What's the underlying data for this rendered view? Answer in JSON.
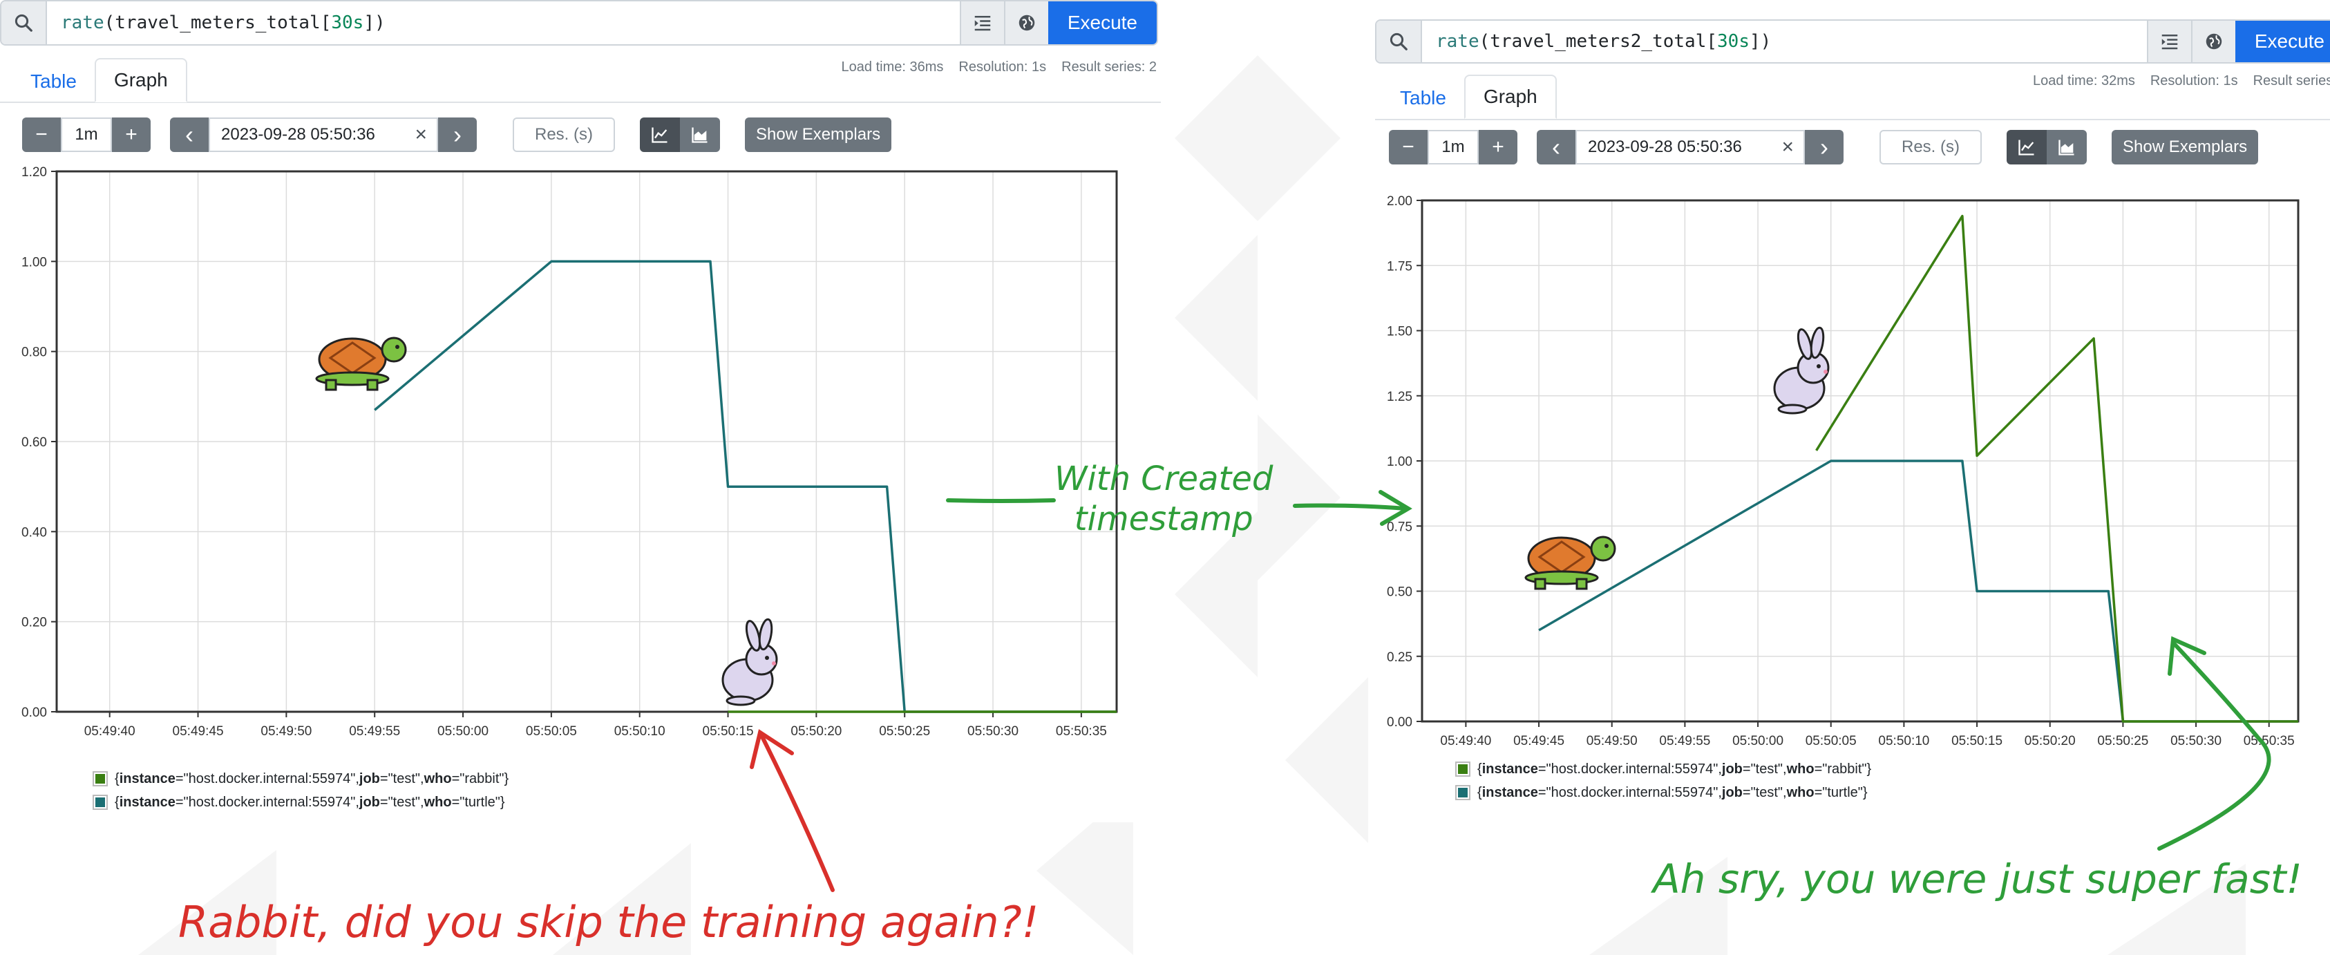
{
  "colors": {
    "rabbit_series": "#3a7f12",
    "turtle_series": "#1b6f73",
    "execute_button": "#1a6ee8",
    "annotation_red": "#d9302b",
    "annotation_green": "#2f9e3a"
  },
  "left_panel": {
    "query": {
      "fn": "rate",
      "metric": "travel_meters_total",
      "range": "30s"
    },
    "execute_label": "Execute",
    "tabs": [
      "Table",
      "Graph"
    ],
    "active_tab": "Graph",
    "stats": {
      "load": "Load time: 36ms",
      "resolution": "Resolution: 1s",
      "series": "Result series: 2"
    },
    "controls": {
      "minus": "−",
      "range": "1m",
      "plus": "+",
      "prev": "‹",
      "end_time": "2023-09-28 05:50:36",
      "clear": "×",
      "next": "›",
      "res_placeholder": "Res. (s)",
      "line_icon": "line-chart-icon",
      "stacked_icon": "stacked-chart-icon",
      "exemplars": "Show Exemplars"
    },
    "legend": [
      {
        "color": "#3a7f12",
        "prefix": "{",
        "k1": "instance",
        "v1": "=\"host.docker.internal:55974\", ",
        "k2": "job",
        "v2": "=\"test\", ",
        "k3": "who",
        "v3": "=\"rabbit\"}"
      },
      {
        "color": "#1b6f73",
        "prefix": "{",
        "k1": "instance",
        "v1": "=\"host.docker.internal:55974\", ",
        "k2": "job",
        "v2": "=\"test\", ",
        "k3": "who",
        "v3": "=\"turtle\"}"
      }
    ]
  },
  "right_panel": {
    "query": {
      "fn": "rate",
      "metric": "travel_meters2_total",
      "range": "30s"
    },
    "execute_label": "Execute",
    "tabs": [
      "Table",
      "Graph"
    ],
    "active_tab": "Graph",
    "stats": {
      "load": "Load time: 32ms",
      "resolution": "Resolution: 1s",
      "series": "Result series:"
    },
    "controls": {
      "minus": "−",
      "range": "1m",
      "plus": "+",
      "prev": "‹",
      "end_time": "2023-09-28 05:50:36",
      "clear": "×",
      "next": "›",
      "res_placeholder": "Res. (s)",
      "exemplars": "Show Exemplars"
    },
    "legend": [
      {
        "color": "#3a7f12",
        "prefix": "{",
        "k1": "instance",
        "v1": "=\"host.docker.internal:55974\", ",
        "k2": "job",
        "v2": "=\"test\", ",
        "k3": "who",
        "v3": "=\"rabbit\"}"
      },
      {
        "color": "#1b6f73",
        "prefix": "{",
        "k1": "instance",
        "v1": "=\"host.docker.internal:55974\", ",
        "k2": "job",
        "v2": "=\"test\", ",
        "k3": "who",
        "v3": "=\"turtle\"}"
      }
    ]
  },
  "annotations": {
    "middle": [
      "With Created",
      "timestamp"
    ],
    "bottom_left": "Rabbit, did you skip the training again?!",
    "bottom_right": "Ah sry, you were just super fast!"
  },
  "chart_data": [
    {
      "type": "line",
      "x_unit": "time",
      "x_ticks": [
        "05:49:40",
        "05:49:45",
        "05:49:50",
        "05:49:55",
        "05:50:00",
        "05:50:05",
        "05:50:10",
        "05:50:15",
        "05:50:20",
        "05:50:25",
        "05:50:30",
        "05:50:35"
      ],
      "y_ticks": [
        "0.00",
        "0.20",
        "0.40",
        "0.60",
        "0.80",
        "1.00",
        "1.20"
      ],
      "ylim": [
        0,
        1.2
      ],
      "xlim": [
        "05:49:37",
        "05:50:37"
      ],
      "grid": true,
      "series": [
        {
          "name": "{instance=\"host.docker.internal:55974\", job=\"test\", who=\"turtle\"}",
          "color": "#1b6f73",
          "points": [
            [
              "05:49:55",
              0.67
            ],
            [
              "05:50:05",
              1.0
            ],
            [
              "05:50:14",
              1.0
            ],
            [
              "05:50:15",
              0.5
            ],
            [
              "05:50:24",
              0.5
            ],
            [
              "05:50:25",
              0.0
            ],
            [
              "05:50:37",
              0.0
            ]
          ]
        },
        {
          "name": "{instance=\"host.docker.internal:55974\", job=\"test\", who=\"rabbit\"}",
          "color": "#3a7f12",
          "points": [
            [
              "05:50:15",
              0.0
            ],
            [
              "05:50:37",
              0.0
            ]
          ]
        }
      ]
    },
    {
      "type": "line",
      "x_unit": "time",
      "x_ticks": [
        "05:49:40",
        "05:49:45",
        "05:49:50",
        "05:49:55",
        "05:50:00",
        "05:50:05",
        "05:50:10",
        "05:50:15",
        "05:50:20",
        "05:50:25",
        "05:50:30",
        "05:50:35"
      ],
      "y_ticks": [
        "0.00",
        "0.25",
        "0.50",
        "0.75",
        "1.00",
        "1.25",
        "1.50",
        "1.75",
        "2.00"
      ],
      "ylim": [
        0,
        2.0
      ],
      "xlim": [
        "05:49:37",
        "05:50:37"
      ],
      "grid": true,
      "series": [
        {
          "name": "{instance=\"host.docker.internal:55974\", job=\"test\", who=\"turtle\"}",
          "color": "#1b6f73",
          "points": [
            [
              "05:49:45",
              0.35
            ],
            [
              "05:50:05",
              1.0
            ],
            [
              "05:50:14",
              1.0
            ],
            [
              "05:50:15",
              0.5
            ],
            [
              "05:50:24",
              0.5
            ],
            [
              "05:50:25",
              0.0
            ],
            [
              "05:50:37",
              0.0
            ]
          ]
        },
        {
          "name": "{instance=\"host.docker.internal:55974\", job=\"test\", who=\"rabbit\"}",
          "color": "#3a7f12",
          "points": [
            [
              "05:50:04",
              1.04
            ],
            [
              "05:50:14",
              1.94
            ],
            [
              "05:50:15",
              1.02
            ],
            [
              "05:50:23",
              1.47
            ],
            [
              "05:50:25",
              0.0
            ],
            [
              "05:50:37",
              0.0
            ]
          ]
        }
      ]
    }
  ]
}
